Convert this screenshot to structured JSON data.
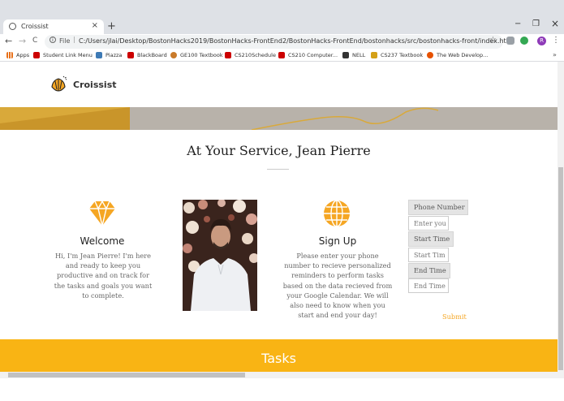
{
  "browser": {
    "tab_title": "Croissist",
    "tab_close": "×",
    "new_tab": "+",
    "window": {
      "minimize": "−",
      "restore": "❐",
      "close": "×"
    },
    "nav": {
      "back": "←",
      "forward": "→",
      "reload": "C"
    },
    "address": {
      "info": "i",
      "scheme": "File",
      "url": "C:/Users/jlai/Desktop/BostonHacks2019/BostonHacks-FrontEnd2/BostonHacks-FrontEnd/bostonhacks/src/bostonhacks-front/index.html",
      "star": "☆"
    },
    "profile_initial": "R",
    "menu": "⋮",
    "bookmarks": [
      {
        "label": "Apps",
        "color": "#e8711a"
      },
      {
        "label": "Student Link Menu",
        "color": "#cc0000"
      },
      {
        "label": "Piazza",
        "color": "#3e7ab5"
      },
      {
        "label": "BlackBoard",
        "color": "#cc0000"
      },
      {
        "label": "GE100 Textbook",
        "color": "#c97a2a"
      },
      {
        "label": "CS210Schedule",
        "color": "#cc0000"
      },
      {
        "label": "CS210 Computer...",
        "color": "#cc0000"
      },
      {
        "label": "NELL",
        "color": "#333333"
      },
      {
        "label": "CS237 Textbook",
        "color": "#d4a017"
      },
      {
        "label": "The Web Develop...",
        "color": "#e65100"
      }
    ],
    "bookmarks_more": "»"
  },
  "site": {
    "brand": "Croissist",
    "section_title": "At Your Service, Jean Pierre",
    "welcome": {
      "title": "Welcome",
      "text": "Hi, I'm Jean Pierre! I'm here and ready to keep you productive and on track for the tasks and goals you want to complete."
    },
    "signup": {
      "title": "Sign Up",
      "text": "Please enter your phone number to recieve personalized reminders to perform tasks based on the data recieved from your Google Calendar. We will also need to know when you start and end your day!"
    },
    "form": {
      "phone_label": "Phone Number",
      "phone_placeholder": "Enter you",
      "start_label": "Start Time",
      "start_placeholder": "Start Tim",
      "end_label": "End Time",
      "end_placeholder": "End Time",
      "submit": "Submit"
    },
    "tasks_title": "Tasks"
  },
  "colors": {
    "accent": "#f9b414",
    "icon_orange": "#f5a623"
  }
}
